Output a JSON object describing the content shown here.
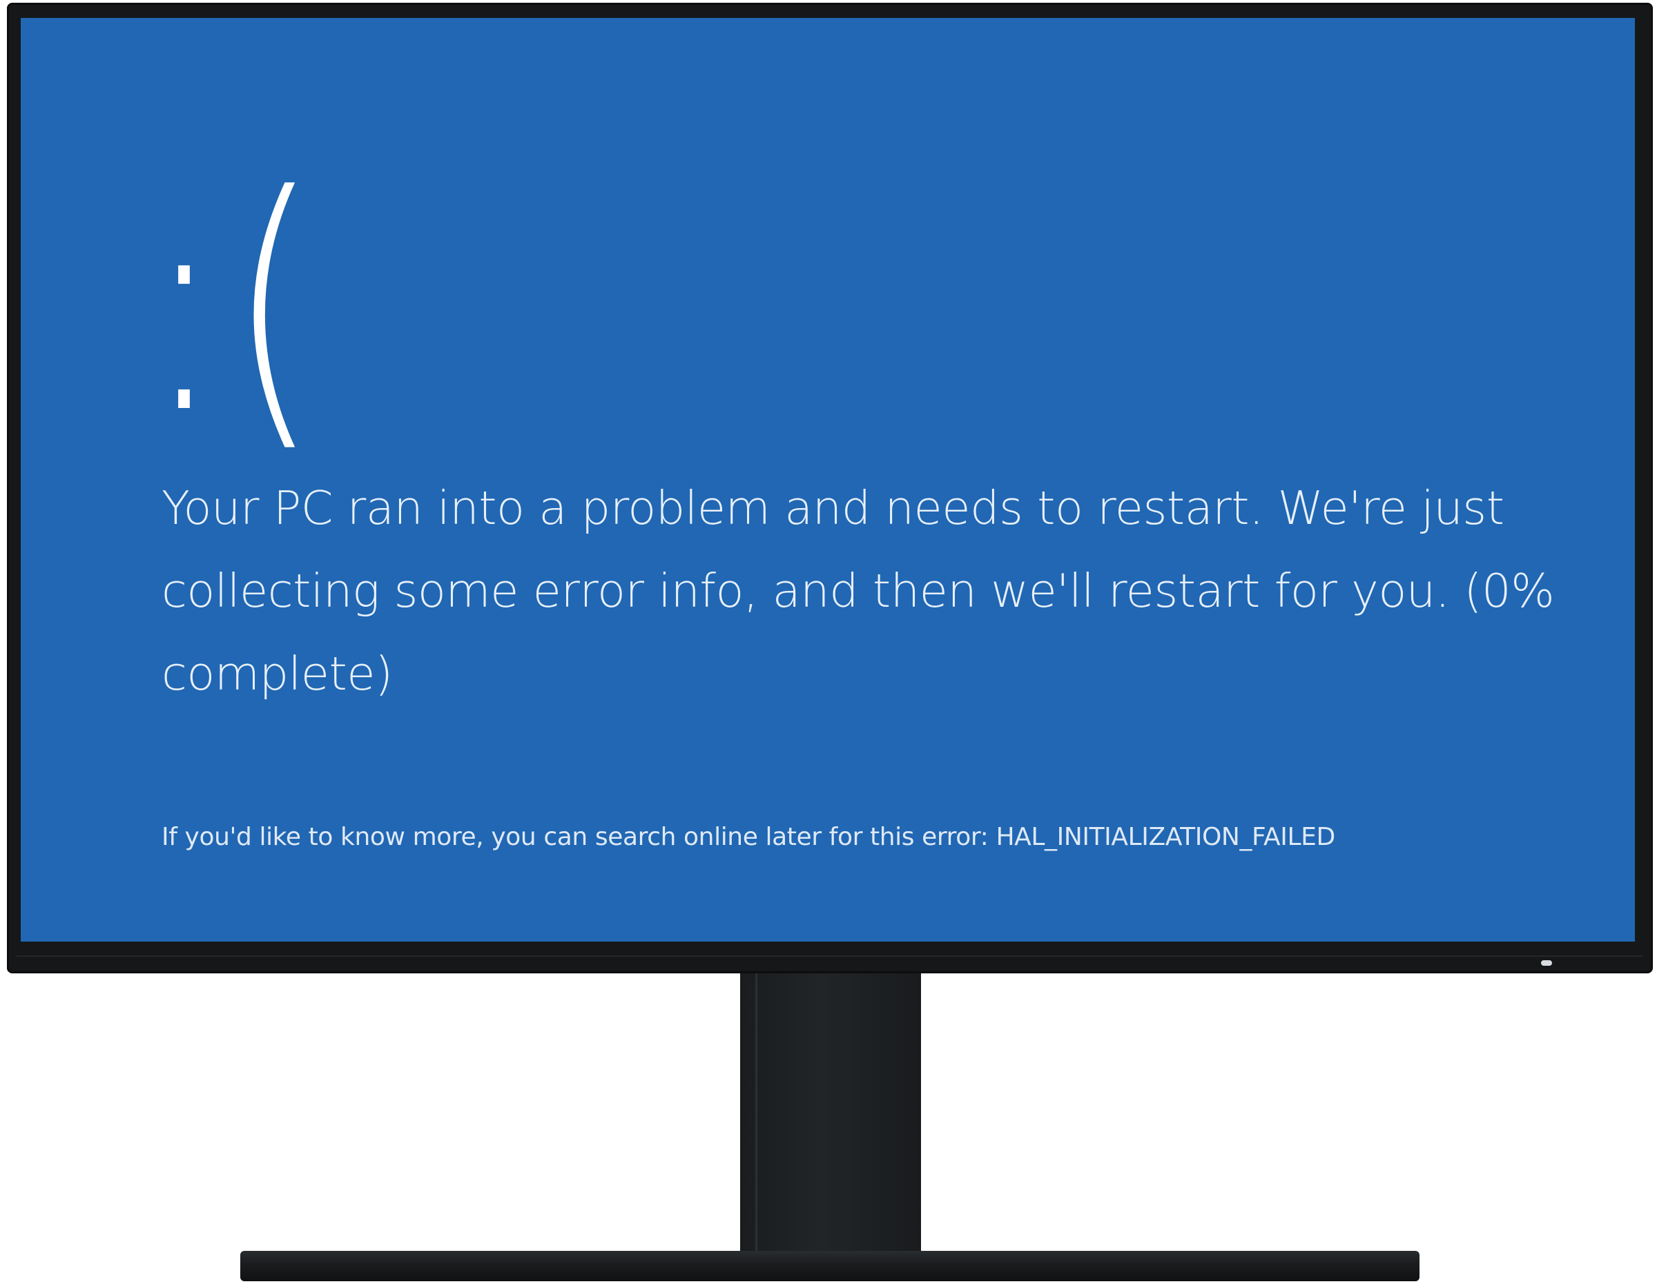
{
  "bsod": {
    "sad_face": ":(",
    "message": "Your PC ran into a problem and needs to restart. We're just collecting some error info, and then we'll restart for you. (0% complete)",
    "more_info": "If you'd like to know more, you can search online later for this error: HAL_INITIALIZATION_FAILED",
    "progress_percent": 0,
    "stop_code": "HAL_INITIALIZATION_FAILED"
  },
  "colors": {
    "screen_background": "#2167b3",
    "text": "#ffffff",
    "monitor_bezel": "#151719"
  }
}
